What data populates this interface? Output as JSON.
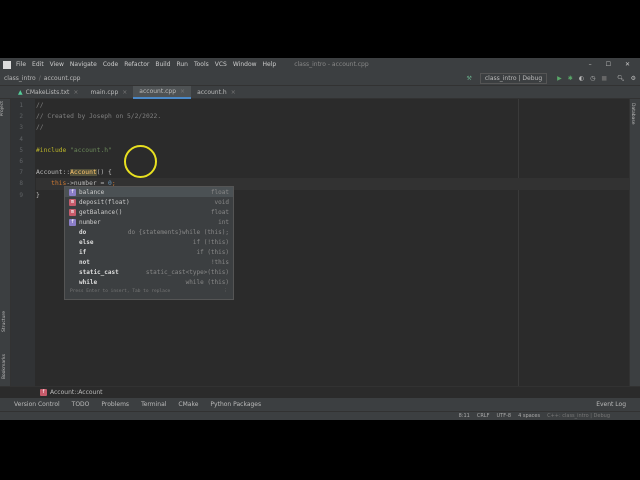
{
  "menu": [
    "File",
    "Edit",
    "View",
    "Navigate",
    "Code",
    "Refactor",
    "Build",
    "Run",
    "Tools",
    "VCS",
    "Window",
    "Help"
  ],
  "window_title": "class_intro - account.cpp",
  "nav": {
    "project": "class_intro",
    "file": "account.cpp",
    "run_config": "class_intro | Debug"
  },
  "tabs": [
    {
      "label": "CMakeLists.txt"
    },
    {
      "label": "main.cpp"
    },
    {
      "label": "account.cpp",
      "active": true
    },
    {
      "label": "account.h"
    }
  ],
  "side": {
    "left_top": "Project",
    "left_mid": "Structure",
    "left_bot": "Bookmarks",
    "right": "Database"
  },
  "line_numbers": [
    "1",
    "2",
    "3",
    "4",
    "5",
    "6",
    "7",
    "8",
    "9"
  ],
  "code": {
    "l1": "//",
    "l2": "// Created by Joseph on 5/2/2022.",
    "l3": "//",
    "l5a": "#include ",
    "l5b": "\"account.h\"",
    "l7a": "Account::",
    "l7b": "Account",
    "l7c": "() {",
    "l8a": "    this",
    "l8b": "->number = ",
    "l8c": "0",
    "l8d": ";",
    "l9": "}"
  },
  "completion": {
    "items": [
      {
        "icon": "f",
        "name": "balance",
        "type": "float"
      },
      {
        "icon": "m",
        "name": "deposit(float)",
        "type": "void"
      },
      {
        "icon": "m",
        "name": "getBalance()",
        "type": "float"
      },
      {
        "icon": "f",
        "name": "number",
        "type": "int"
      },
      {
        "icon": "",
        "name": "do",
        "type": "do {statements}while (this);"
      },
      {
        "icon": "",
        "name": "else",
        "type": "if (!this)"
      },
      {
        "icon": "",
        "name": "if",
        "type": "if (this)"
      },
      {
        "icon": "",
        "name": "not",
        "type": "!this"
      },
      {
        "icon": "",
        "name": "static_cast",
        "type": "static_cast<type>(this)"
      },
      {
        "icon": "",
        "name": "while",
        "type": "while (this)"
      }
    ],
    "footer": "Press Enter to insert, Tab to replace"
  },
  "breadcrumb": "Account::Account",
  "toolwindows": [
    "Version Control",
    "TODO",
    "Problems",
    "Terminal",
    "CMake",
    "Python Packages"
  ],
  "event_log": "Event Log",
  "status": {
    "pos": "8:11",
    "eol": "CRLF",
    "enc": "UTF-8",
    "indent": "4 spaces",
    "ctx": "C++: class_intro | Debug"
  }
}
